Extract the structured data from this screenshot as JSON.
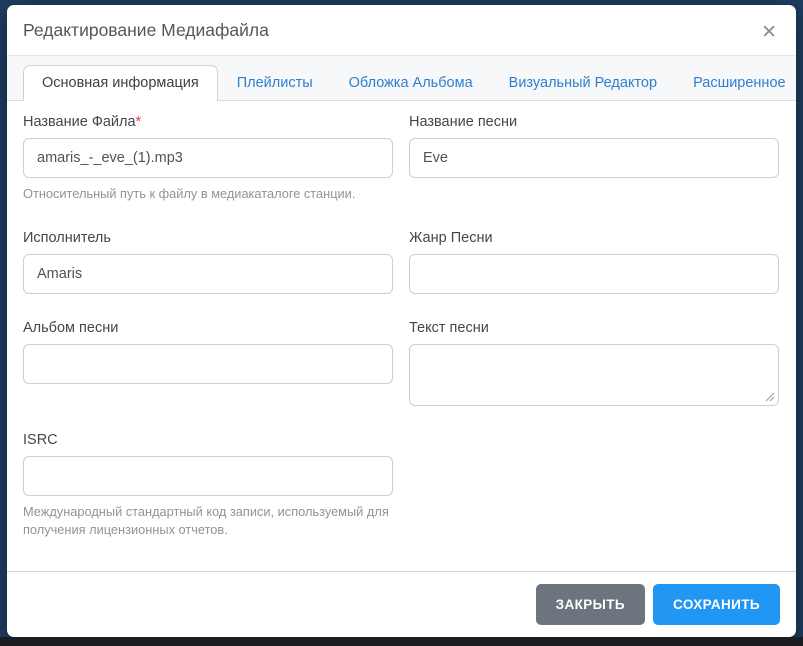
{
  "modal": {
    "title": "Редактирование Медиафайла",
    "close_glyph": "✕"
  },
  "tabs": [
    {
      "label": "Основная информация",
      "active": true
    },
    {
      "label": "Плейлисты",
      "active": false
    },
    {
      "label": "Обложка Альбома",
      "active": false
    },
    {
      "label": "Визуальный Редактор",
      "active": false
    },
    {
      "label": "Расширенное",
      "active": false
    }
  ],
  "fields": {
    "file_name": {
      "label": "Название Файла",
      "required_marker": "*",
      "value": "amaris_-_eve_(1).mp3",
      "help": "Относительный путь к файлу в медиакаталоге станции."
    },
    "song_title": {
      "label": "Название песни",
      "value": "Eve"
    },
    "artist": {
      "label": "Исполнитель",
      "value": "Amaris"
    },
    "genre": {
      "label": "Жанр Песни",
      "value": ""
    },
    "album": {
      "label": "Альбом песни",
      "value": ""
    },
    "lyrics": {
      "label": "Текст песни",
      "value": ""
    },
    "isrc": {
      "label": "ISRC",
      "value": "",
      "help": "Международный стандартный код записи, используемый для получения лицензионных отчетов."
    }
  },
  "footer": {
    "close_label": "ЗАКРЫТЬ",
    "save_label": "СОХРАНИТЬ"
  },
  "colors": {
    "accent_blue": "#2196f3",
    "tab_link_blue": "#2e7fd0",
    "secondary_button_gray": "#6c757d",
    "required_red": "#f13d34",
    "backdrop_navy": "#1e3e62"
  }
}
